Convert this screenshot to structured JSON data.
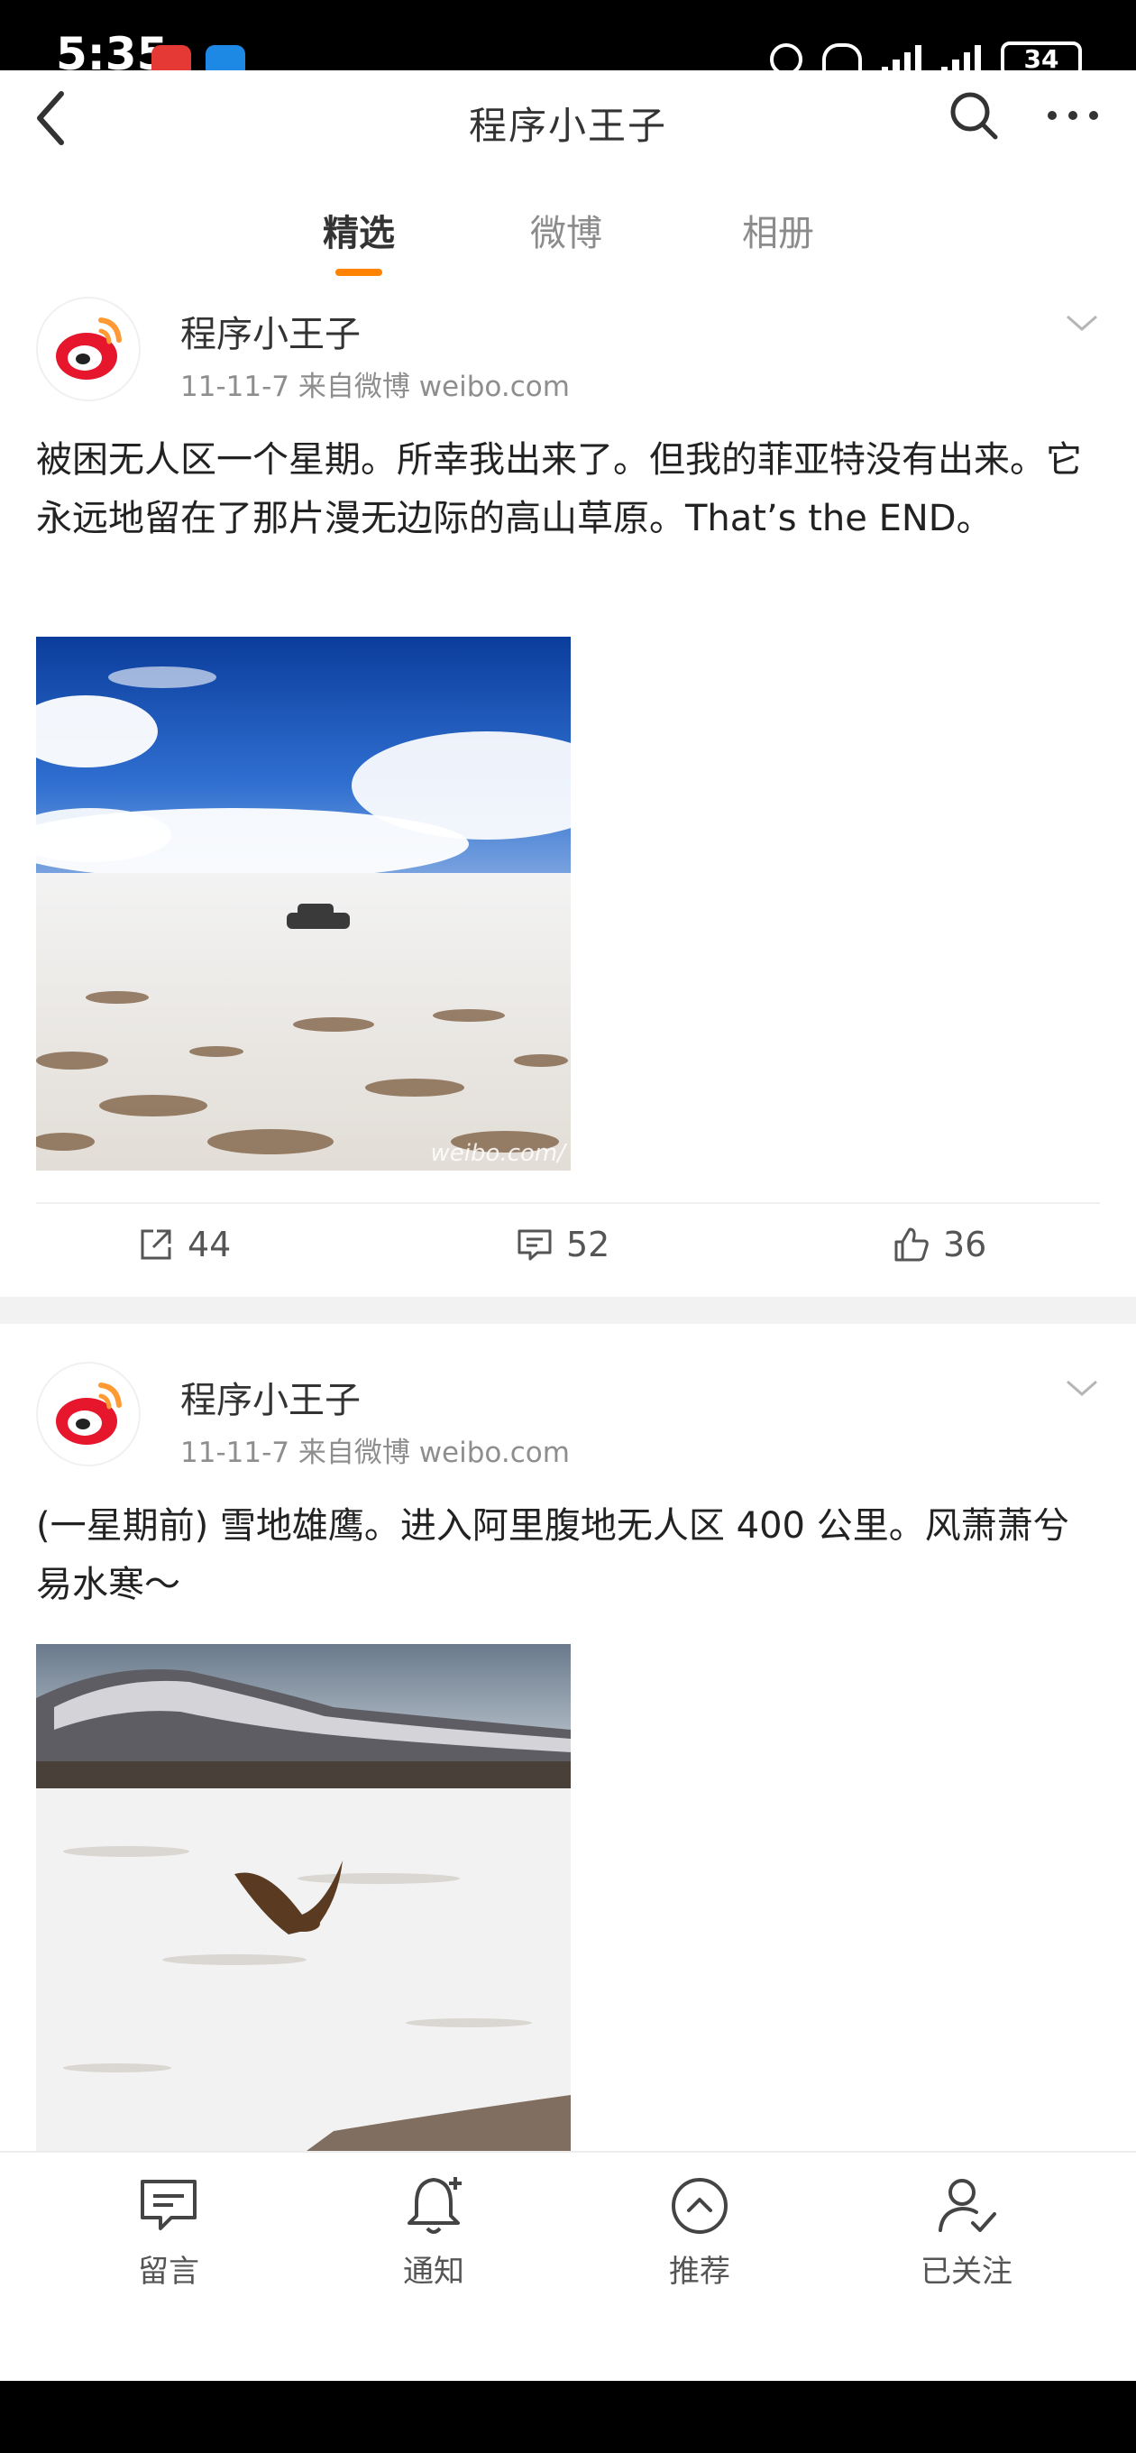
{
  "status_bar": {
    "time": "5:35",
    "battery": "34"
  },
  "header": {
    "title": "程序小王子"
  },
  "tabs": [
    {
      "label": "精选",
      "active": true
    },
    {
      "label": "微博",
      "active": false
    },
    {
      "label": "相册",
      "active": false
    }
  ],
  "posts": [
    {
      "author": "程序小王子",
      "meta": "11-11-7  来自微博 weibo.com",
      "text": "被困无人区一个星期。所幸我出来了。但我的菲亚特没有出来。它永远地留在了那片漫无边际的高山草原。That’s the END。",
      "image_watermark": "weibo.com/",
      "shares": "44",
      "comments": "52",
      "likes": "36"
    },
    {
      "author": "程序小王子",
      "meta": "11-11-7  来自微博 weibo.com",
      "text": "(一星期前) 雪地雄鹰。进入阿里腹地无人区 400 公里。风萧萧兮易水寒～"
    }
  ],
  "bottom_nav": [
    {
      "label": "留言",
      "icon": "message-icon"
    },
    {
      "label": "通知",
      "icon": "bell-icon"
    },
    {
      "label": "推荐",
      "icon": "recommend-icon"
    },
    {
      "label": "已关注",
      "icon": "followed-user-icon"
    }
  ],
  "colors": {
    "accent": "#ff8200",
    "weibo_red": "#e6162d"
  }
}
